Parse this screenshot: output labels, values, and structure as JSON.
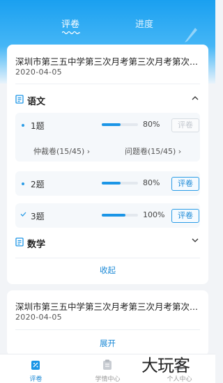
{
  "tabs": {
    "review": "评卷",
    "progress": "进度"
  },
  "exams": [
    {
      "title": "深圳市第三五中学第三次月考第三次月考第次...",
      "date": "2020-04-05",
      "subjects": [
        {
          "name": "语文",
          "questions": [
            {
              "label": "1题",
              "progress_percent": 80,
              "percent_text": "80%",
              "button": "评卷",
              "button_enabled": false,
              "links": [
                "仲裁卷(15/45)",
                "问题卷(15/45)"
              ]
            },
            {
              "label": "2题",
              "progress_percent": 80,
              "percent_text": "80%",
              "button": "评卷",
              "button_enabled": true
            },
            {
              "label": "3题",
              "progress_percent": 100,
              "percent_text": "100%",
              "button": "评卷",
              "button_enabled": true
            }
          ]
        },
        {
          "name": "数学"
        }
      ],
      "toggle": "收起"
    },
    {
      "title": "深圳市第三五中学第三次月考第三次月考第次...",
      "date": "2020-04-05",
      "toggle": "展开"
    }
  ],
  "bottom_nav": [
    {
      "label": "评卷",
      "icon": "review-icon",
      "active": true
    },
    {
      "label": "学情中心",
      "icon": "clipboard-icon",
      "active": false
    },
    {
      "label": "个人中心",
      "icon": "person-icon",
      "active": false
    }
  ],
  "watermark": "大玩客",
  "colors": {
    "accent": "#1b95e6",
    "header": "#1aa0f0"
  }
}
